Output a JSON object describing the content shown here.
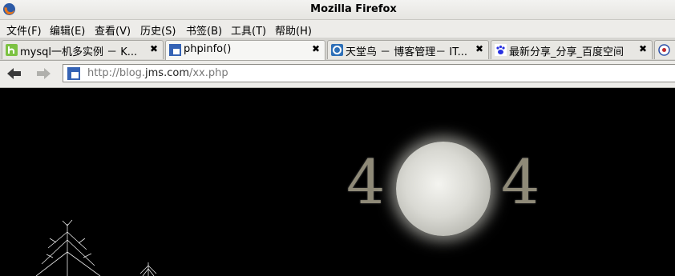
{
  "window": {
    "title": "Mozilla Firefox"
  },
  "menu": [
    {
      "label": "文件(F)"
    },
    {
      "label": "编辑(E)"
    },
    {
      "label": "查看(V)"
    },
    {
      "label": "历史(S)"
    },
    {
      "label": "书签(B)"
    },
    {
      "label": "工具(T)"
    },
    {
      "label": "帮助(H)"
    }
  ],
  "tabs": [
    {
      "label": "mysql一机多实例 － K...",
      "close": "✖"
    },
    {
      "label": "phpinfo()",
      "close": "✖"
    },
    {
      "label": "天堂鸟 － 博客管理－ IT...",
      "close": "✖"
    },
    {
      "label": "最新分享_分享_百度空间",
      "close": "✖"
    }
  ],
  "address": {
    "prefix": "http://blog.",
    "host": "jms.com",
    "path": "/xx.php"
  },
  "page": {
    "digit_left": "4",
    "digit_right": "4"
  },
  "icons": {
    "app": "firefox-icon",
    "back": "back-arrow-icon",
    "forward": "forward-arrow-icon",
    "site": "site-favicon-icon"
  }
}
